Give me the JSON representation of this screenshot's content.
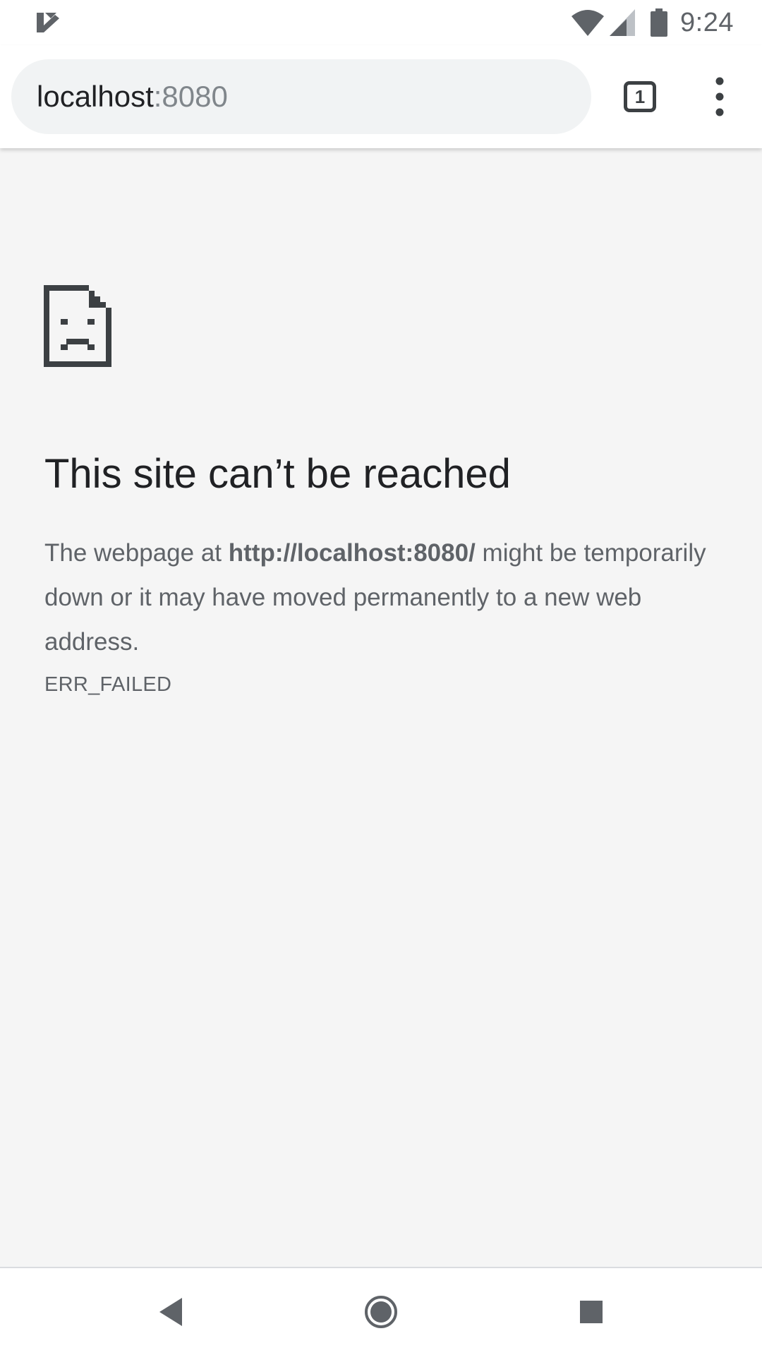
{
  "status_bar": {
    "time": "9:24",
    "icons": [
      "app-notification-icon",
      "wifi-icon",
      "signal-icon",
      "battery-icon"
    ]
  },
  "toolbar": {
    "url_host": "localhost",
    "url_port": ":8080",
    "tab_count": "1",
    "menu_icon": "more-vert-icon"
  },
  "error": {
    "icon": "sad-document-icon",
    "title": "This site can’t be reached",
    "desc_prefix": "The webpage at ",
    "desc_url": "http://localhost:8080/",
    "desc_suffix": " might be temporarily down or it may have moved permanently to a new web address.",
    "code": "ERR_FAILED"
  },
  "nav_bar": {
    "buttons": [
      "back-icon",
      "home-icon",
      "recents-icon"
    ]
  },
  "colors": {
    "page_background": "#f5f5f5",
    "toolbar_background": "#ffffff",
    "omnibox_background": "#f1f3f4",
    "title_text": "#202124",
    "body_text": "#5f6368"
  }
}
